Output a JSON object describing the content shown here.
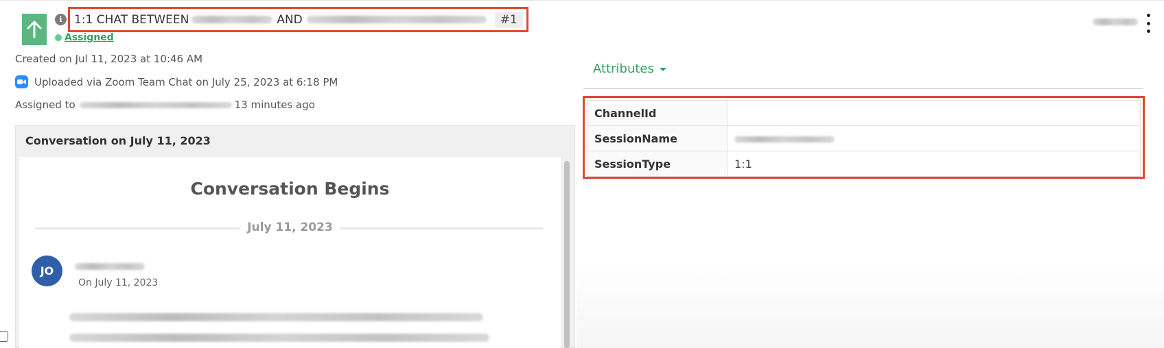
{
  "header": {
    "title_prefix": "1:1 CHAT BETWEEN",
    "title_and": "AND",
    "conversation_number": "#1",
    "status_label": "Assigned"
  },
  "meta": {
    "created": "Created on Jul 11, 2023 at 10:46 AM",
    "uploaded": "Uploaded via Zoom Team Chat on July 25, 2023 at 6:18 PM",
    "assigned_prefix": "Assigned to",
    "assigned_suffix": "13 minutes ago"
  },
  "conversation": {
    "header": "Conversation on July 11, 2023",
    "begins_label": "Conversation Begins",
    "date_divider": "July 11, 2023",
    "message": {
      "avatar_initials": "JO",
      "date": "On July 11, 2023"
    }
  },
  "attributes": {
    "toggle_label": "Attributes",
    "rows": [
      {
        "key": "ChannelId",
        "value": ""
      },
      {
        "key": "SessionName",
        "value": ""
      },
      {
        "key": "SessionType",
        "value": "1:1"
      }
    ]
  },
  "colors": {
    "accent_green": "#2ea35f",
    "highlight_red": "#e04a32",
    "avatar_blue": "#2f5fa8",
    "zoom_blue": "#2d8cff"
  },
  "icons": {
    "upload": "arrow-up-icon",
    "info": "info-icon",
    "zoom": "zoom-icon",
    "more": "more-vertical-icon"
  }
}
